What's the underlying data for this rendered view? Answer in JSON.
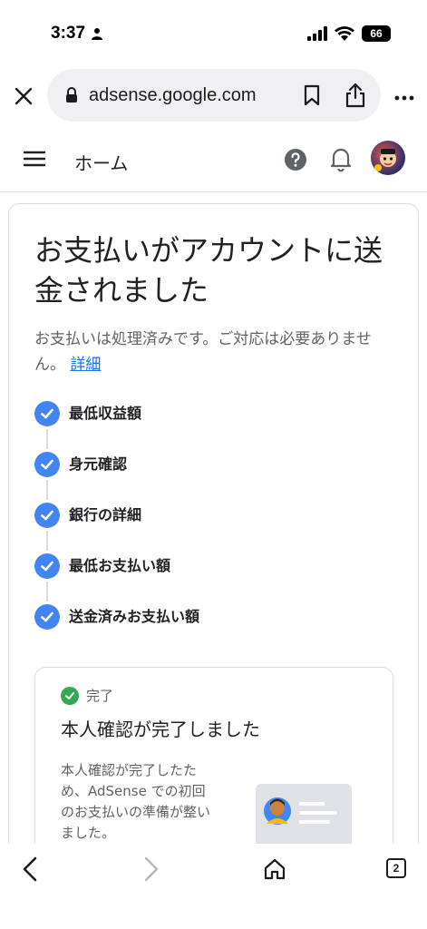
{
  "status": {
    "time": "3:37",
    "battery": "66"
  },
  "browser": {
    "url": "adsense.google.com"
  },
  "appbar": {
    "title": "ホーム"
  },
  "card": {
    "headline": "お支払いがアカウントに送金されました",
    "description": "お支払いは処理済みです。ご対応は必要ありません。",
    "details_link": "詳細",
    "steps": [
      {
        "label": "最低収益額"
      },
      {
        "label": "身元確認"
      },
      {
        "label": "銀行の詳細"
      },
      {
        "label": "最低お支払い額"
      },
      {
        "label": "送金済みお支払い額"
      }
    ],
    "status_card": {
      "status": "完了",
      "title": "本人確認が完了しました",
      "body": "本人確認が完了したため、AdSense での初回のお支払いの準備が整いました。"
    }
  },
  "toolbar": {
    "tabs_count": "2"
  },
  "colors": {
    "accent": "#4285f4",
    "success": "#34a853",
    "link": "#1a73e8"
  }
}
